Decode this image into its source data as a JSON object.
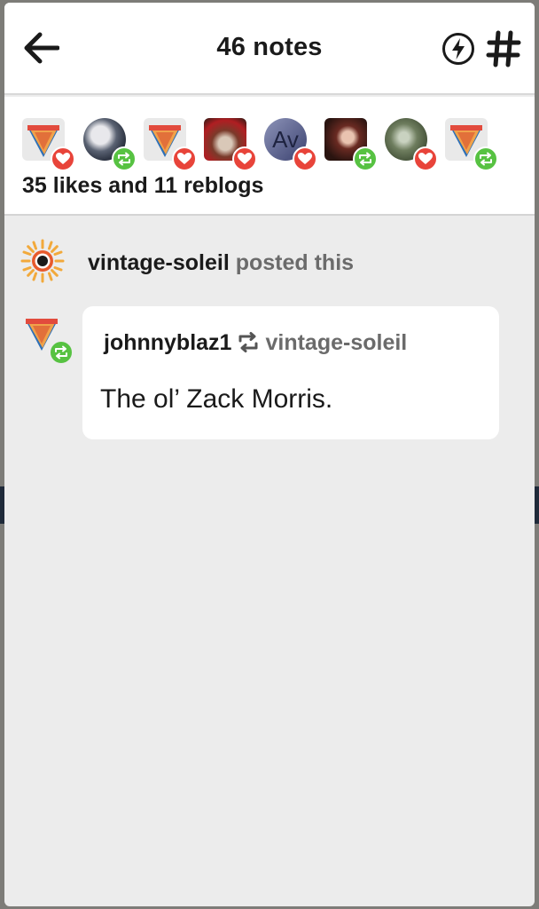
{
  "header": {
    "title": "46 notes",
    "back_icon": "arrow-left-icon",
    "bolt_icon": "bolt-circle-icon",
    "hash_icon": "hashtag-icon"
  },
  "summary": {
    "counts_text": "35 likes and 11 reblogs",
    "avatars": [
      {
        "kind": "cone",
        "action": "like"
      },
      {
        "kind": "photo-dark",
        "action": "reblog"
      },
      {
        "kind": "cone",
        "action": "like"
      },
      {
        "kind": "photo-red",
        "action": "like"
      },
      {
        "kind": "letters",
        "text": "Av",
        "action": "like"
      },
      {
        "kind": "photo-woman",
        "action": "reblog"
      },
      {
        "kind": "photo-green",
        "action": "like"
      },
      {
        "kind": "cone",
        "action": "reblog"
      }
    ]
  },
  "post": {
    "poster_name": "vintage-soleil",
    "poster_suffix": "posted this"
  },
  "reblog": {
    "user": "johnnyblaz1",
    "source": "vintage-soleil",
    "body": "The ol’ Zack Morris."
  },
  "colors": {
    "like": "#e8443a",
    "reblog": "#57c242",
    "panel_bg": "#ececec",
    "text_primary": "#1a1a1a",
    "text_secondary": "#6b6b6b"
  }
}
